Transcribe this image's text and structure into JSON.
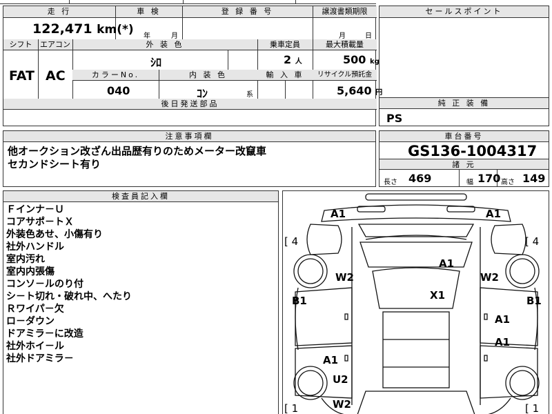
{
  "top_partial": {
    "glyphs": "昌 清 秒"
  },
  "mileage": {
    "header": "走 行",
    "value": "122,471",
    "unit": "km(*)"
  },
  "inspection": {
    "header": "車 検",
    "year": "年",
    "month": "月"
  },
  "registration": {
    "header": "登 録 番 号"
  },
  "transfer_deadline": {
    "header": "譲渡書類期限",
    "month": "月",
    "day": "日"
  },
  "sales_points": {
    "header": "セールスポイント"
  },
  "shift": {
    "header": "シフト",
    "value": "FAT"
  },
  "aircon": {
    "header": "エアコン",
    "value": "AC"
  },
  "exterior_color": {
    "header": "外 装 色",
    "value": "ｼﾛ"
  },
  "capacity": {
    "header": "乗車定員",
    "value": "2",
    "unit": "人"
  },
  "max_load": {
    "header": "最大積載量",
    "value": "500",
    "unit": "kg"
  },
  "color_no": {
    "header": "カラーNo.",
    "value": "040"
  },
  "interior_color": {
    "header": "内 装 色",
    "value": "ｺﾝ",
    "suffix": "系"
  },
  "import": {
    "header": "輸 入 車"
  },
  "recycle": {
    "header": "リサイクル預託金",
    "value": "5,640",
    "unit": "円"
  },
  "later_parts": {
    "header": "後日発送部品"
  },
  "genuine_equipment": {
    "header": "純 正 装 備",
    "value": "PS"
  },
  "notes": {
    "header": "注意事項欄",
    "lines": [
      "他オークション改ざん出品歴有りのためメーター改竄車",
      "セカンドシート有り"
    ]
  },
  "chassis": {
    "header": "車台番号",
    "value": "GS136-1004317"
  },
  "specs": {
    "header": "諸 元",
    "length_label": "長さ",
    "length": "469",
    "width_label": "幅",
    "width": "170",
    "height_label": "高さ",
    "height": "149"
  },
  "inspector": {
    "header": "検査員記入欄",
    "lines": [
      "Ｆインナ－Ｕ",
      "コアサポ－トＸ",
      "外装色あせ、小傷有り",
      "社外ハンドル",
      "室内汚れ",
      "室内内張傷",
      "コンソ－ルのり付",
      "シ－ト切れ・破れ中、へたり",
      "Ｒワイパ－欠",
      "ロ－ダウン",
      "ドアミラ－に改造",
      "社外ホイ－ル",
      "社外ドアミラ－"
    ]
  },
  "diagram": {
    "bracket_tl": "[ 4",
    "bracket_tr": "[ 4",
    "bracket_bl": "[ 1",
    "bracket_br": "[ 1",
    "marks": {
      "a1_tl": "A1",
      "a1_tr": "A1",
      "a1_roof": "A1",
      "w2_left": "W2",
      "w2_right": "W2",
      "b1_left": "B1",
      "b1_right": "B1",
      "x1_center": "X1",
      "a1_rdoor1": "A1",
      "a1_rdoor2": "A1",
      "a1_ldoor": "A1",
      "u2_left": "U2",
      "w2_lrear": "W2"
    }
  }
}
